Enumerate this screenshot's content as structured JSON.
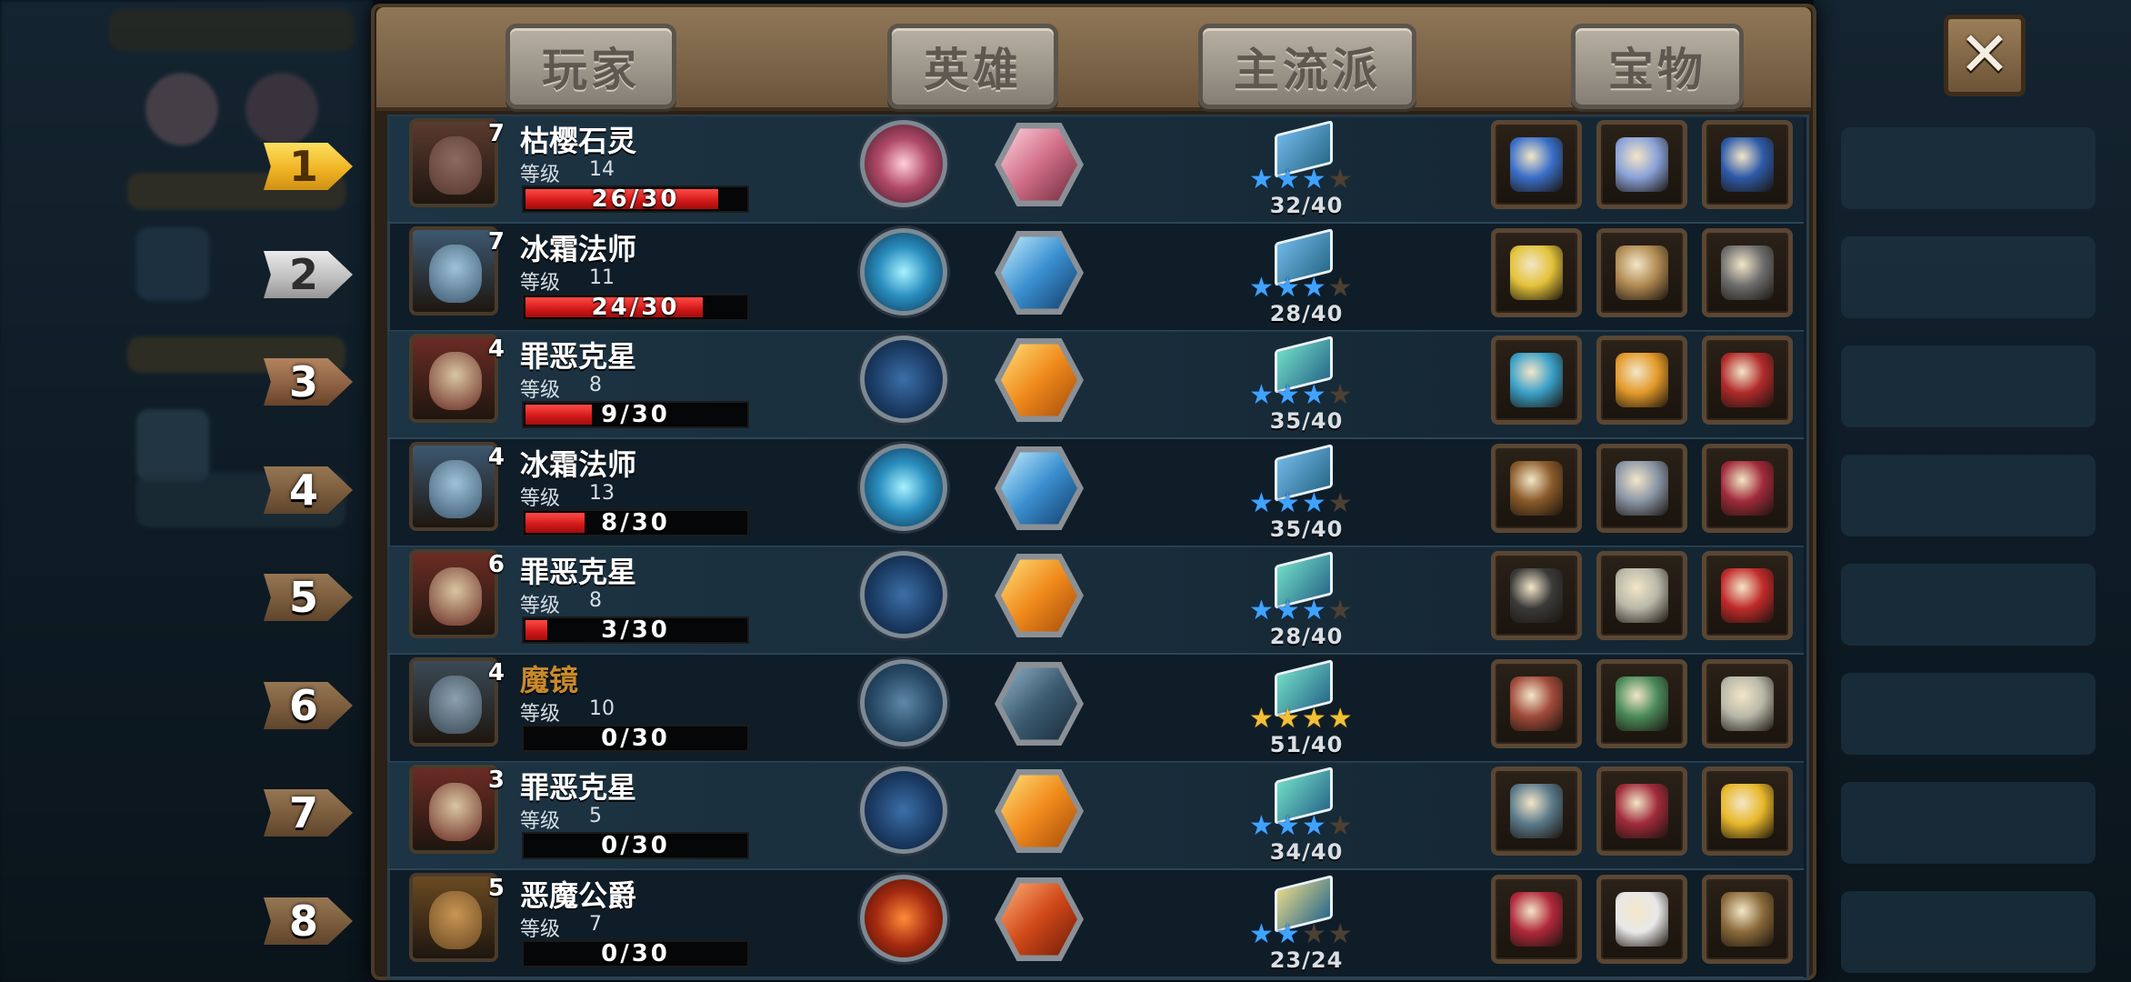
{
  "tabs": [
    "玩家",
    "英雄",
    "主流派",
    "宝物"
  ],
  "close_label": "✕",
  "level_label": "等级",
  "rows": [
    {
      "rank": "1",
      "badge": "7",
      "name": "枯樱石灵",
      "level": "14",
      "progress": "26/30",
      "fill": 0.867,
      "stars_filled": 3,
      "stars_color": "blue",
      "count": "32/40",
      "treasures": [
        "feather-staff-icon",
        "blue-gem-ring-icon",
        "treasure-chest-icon"
      ]
    },
    {
      "rank": "2",
      "badge": "7",
      "name": "冰霜法师",
      "level": "11",
      "progress": "24/30",
      "fill": 0.8,
      "stars_filled": 3,
      "stars_color": "blue",
      "count": "28/40",
      "treasures": [
        "golden-chalice-icon",
        "balance-scale-icon",
        "stone-tablet-icon"
      ]
    },
    {
      "rank": "3",
      "badge": "4",
      "name": "罪恶克星",
      "level": "8",
      "progress": "9/30",
      "fill": 0.3,
      "stars_filled": 3,
      "stars_color": "blue",
      "count": "35/40",
      "treasures": [
        "crystal-scepter-icon",
        "vip-card-icon",
        "red-rocket-icon"
      ]
    },
    {
      "rank": "4",
      "badge": "4",
      "name": "冰霜法师",
      "level": "13",
      "progress": "8/30",
      "fill": 0.267,
      "stars_filled": 3,
      "stars_color": "blue",
      "count": "35/40",
      "treasures": [
        "leather-armor-icon",
        "metal-boot-icon",
        "spell-book-icon"
      ]
    },
    {
      "rank": "5",
      "badge": "6",
      "name": "罪恶克星",
      "level": "8",
      "progress": "3/30",
      "fill": 0.1,
      "stars_filled": 3,
      "stars_color": "blue",
      "count": "28/40",
      "treasures": [
        "pirate-hat-icon",
        "silver-coin-icon",
        "red-book-icon"
      ]
    },
    {
      "rank": "6",
      "badge": "4",
      "name": "魔镜",
      "level": "10",
      "progress": "0/30",
      "fill": 0,
      "stars_filled": 4,
      "stars_color": "gold",
      "count": "51/40",
      "treasures": [
        "demon-mask-icon",
        "green-tome-icon",
        "silver-coin-icon"
      ]
    },
    {
      "rank": "7",
      "badge": "3",
      "name": "罪恶克星",
      "level": "5",
      "progress": "0/30",
      "fill": 0,
      "stars_filled": 3,
      "stars_color": "blue",
      "count": "34/40",
      "treasures": [
        "lantern-device-icon",
        "spell-book-icon",
        "golden-crown-icon"
      ]
    },
    {
      "rank": "8",
      "badge": "5",
      "name": "恶魔公爵",
      "level": "7",
      "progress": "0/30",
      "fill": 0,
      "stars_filled": 2,
      "stars_color": "blue",
      "count": "23/24",
      "treasures": [
        "berry-goblet-icon",
        "first-aid-kit-icon",
        "telescope-icon"
      ]
    }
  ]
}
